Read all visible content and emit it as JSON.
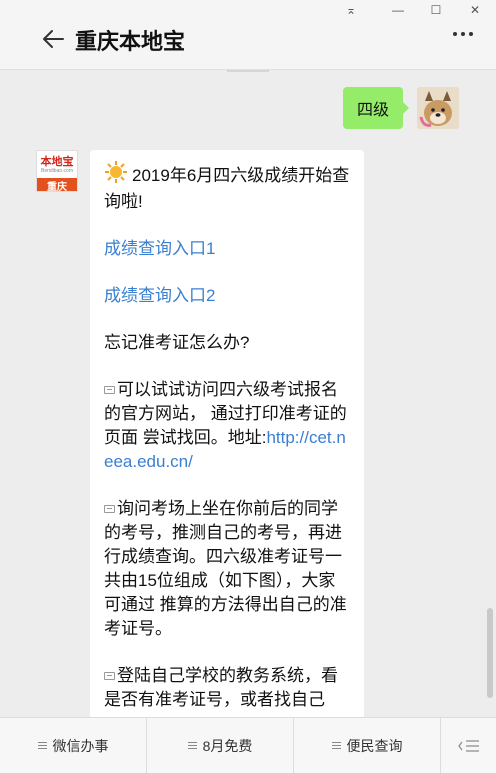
{
  "header": {
    "title": "重庆本地宝"
  },
  "window_controls": {
    "pin": "⌅",
    "minimize": "—",
    "maximize": "☐",
    "close": "✕"
  },
  "outgoing_message": {
    "text": "四级"
  },
  "bot_avatar": {
    "brand": "本地宝",
    "site": "Bendibao.com",
    "city": "重庆"
  },
  "incoming_message": {
    "headline": "2019年6月四六级成绩开始查询啦!",
    "link1": "成绩查询入口1",
    "link2": "成绩查询入口2",
    "question": "忘记准考证怎么办?",
    "tip1_text": "可以试试访问四六级考试报名的官方网站， 通过打印准考证的页面 尝试找回。地址:",
    "tip1_url": "http://cet.neea.edu.cn/",
    "tip2_text": "询问考场上坐在你前后的同学的考号，推测自己的考号，再进行成绩查询。四六级准考证号一共由15位组成（如下图），大家可通过 推算的方法得出自己的准考证号。",
    "tip3_text": "登陆自己学校的教务系统，看是否有准考证号，或者找自己"
  },
  "bottom_menu": {
    "items": [
      {
        "label": "微信办事"
      },
      {
        "label": "8月免费"
      },
      {
        "label": "便民查询"
      }
    ]
  },
  "colors": {
    "outgoing_bubble": "#95ec69",
    "link": "#3a7fd1",
    "brand_red": "#d3251b",
    "brand_orange": "#e3511f"
  }
}
